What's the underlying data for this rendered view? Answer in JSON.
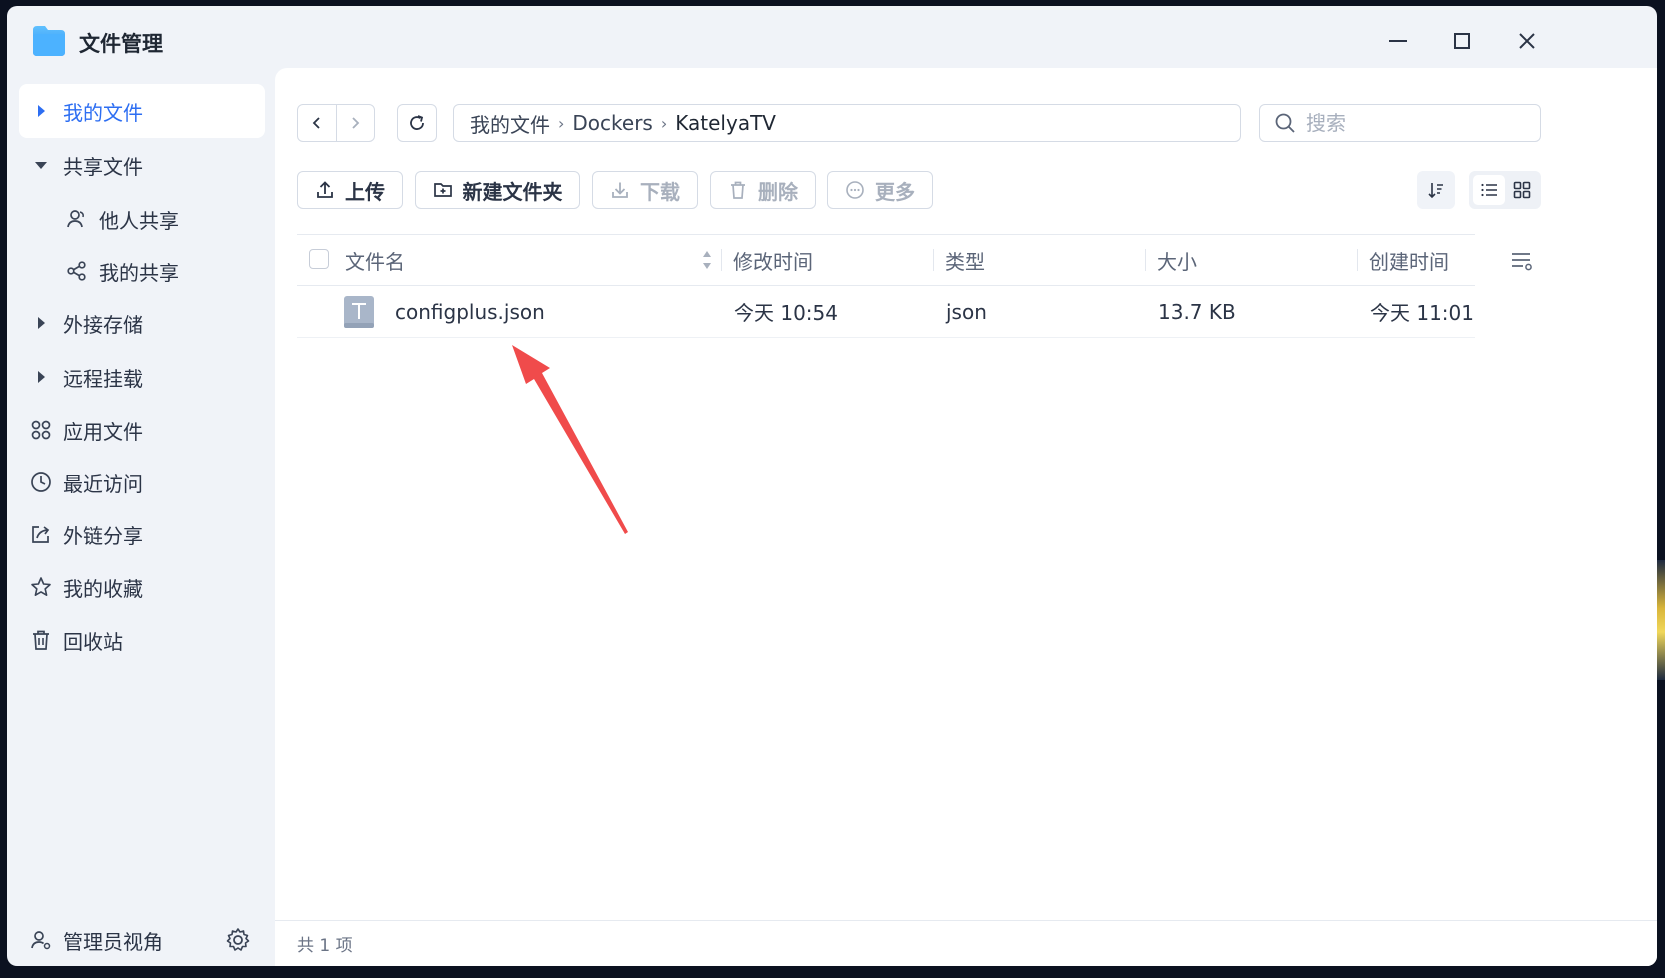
{
  "window": {
    "title": "文件管理"
  },
  "sidebar": {
    "items": [
      {
        "label": "我的文件"
      },
      {
        "label": "共享文件"
      },
      {
        "label": "他人共享"
      },
      {
        "label": "我的共享"
      },
      {
        "label": "外接存储"
      },
      {
        "label": "远程挂载"
      },
      {
        "label": "应用文件"
      },
      {
        "label": "最近访问"
      },
      {
        "label": "外链分享"
      },
      {
        "label": "我的收藏"
      },
      {
        "label": "回收站"
      }
    ],
    "admin_label": "管理员视角"
  },
  "breadcrumb": [
    "我的文件",
    "Dockers",
    "KatelyaTV"
  ],
  "search": {
    "placeholder": "搜索"
  },
  "toolbar": {
    "upload": "上传",
    "new_folder": "新建文件夹",
    "download": "下载",
    "delete": "删除",
    "more": "更多"
  },
  "table": {
    "columns": [
      "文件名",
      "修改时间",
      "类型",
      "大小",
      "创建时间"
    ],
    "rows": [
      {
        "name": "configplus.json",
        "modified": "今天 10:54",
        "type": "json",
        "size": "13.7 KB",
        "created": "今天 11:01"
      }
    ]
  },
  "status": {
    "count_text": "共 1 项"
  },
  "colors": {
    "accent": "#2d6ef2",
    "annotation_arrow": "#f04b4b"
  }
}
